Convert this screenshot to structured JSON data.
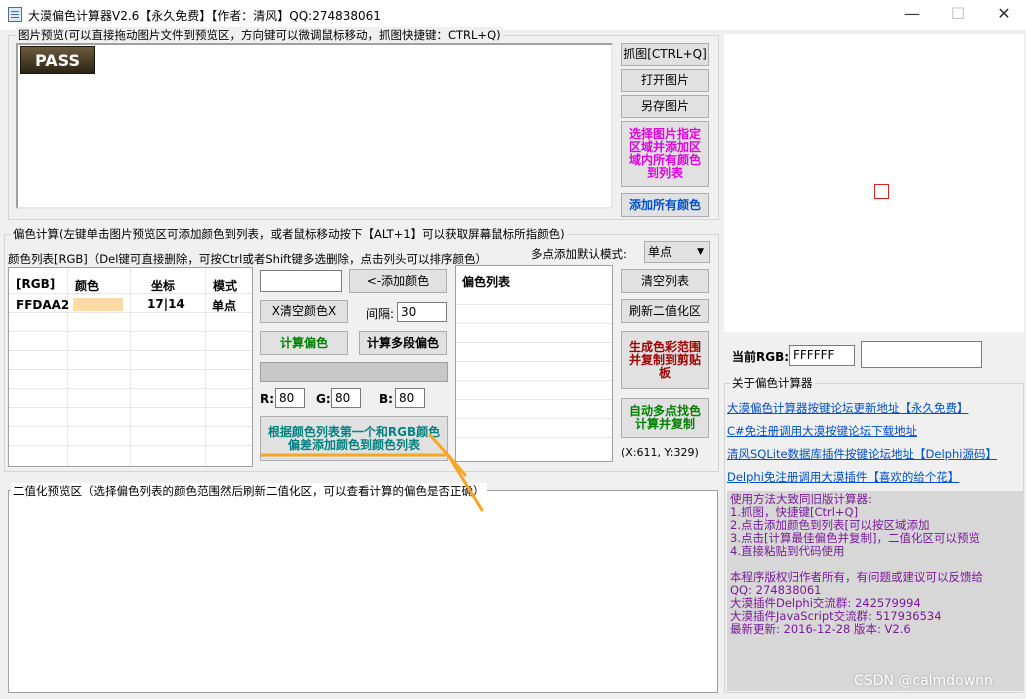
{
  "window": {
    "title": "大漠偏色计算器V2.6【永久免费】【作者：清风】QQ:274838061",
    "minimize": "—",
    "maximize": "☐",
    "close": "✕"
  },
  "preview_group": {
    "label": "图片预览(可以直接拖动图片文件到预览区，方向键可以微调鼠标移动，抓图快捷键：CTRL+Q)",
    "pass_image_text": "PASS"
  },
  "preview_buttons": {
    "capture": "抓图[CTRL+Q]",
    "open": "打开图片",
    "save_as": "另存图片",
    "select_region": "选择图片指定区域并添加区域内所有颜色到列表",
    "add_all": "添加所有颜色"
  },
  "calc_group": {
    "label": "偏色计算(左键单击图片预览区可添加颜色到列表，或者鼠标移动按下【ALT+1】可以获取屏幕鼠标所指颜色)",
    "list_label": "颜色列表[RGB]（Del键可直接删除，可按Ctrl或者Shift键多选删除，点击列头可以排序颜色）",
    "multi_mode_label": "多点添加默认模式:",
    "multi_mode_value": "单点"
  },
  "color_table": {
    "headers": [
      "[RGB]",
      "颜色",
      "坐标",
      "模式"
    ],
    "rows": [
      {
        "rgb": "FFDAA2",
        "swatch": "#FFDAA2",
        "coord": "17|14",
        "mode": "单点"
      }
    ]
  },
  "middle_controls": {
    "color_input": "",
    "add_color": "<-添加颜色",
    "clear_color": "X清空颜色X",
    "interval_label": "间隔:",
    "interval_value": "30",
    "calc_offset": "计算偏色",
    "calc_multi": "计算多段偏色",
    "r_label": "R:",
    "r_value": "80",
    "g_label": "G:",
    "g_value": "80",
    "b_label": "B:",
    "b_value": "80",
    "add_by_diff": "根据颜色列表第一个和RGB颜色偏差添加颜色到颜色列表"
  },
  "offset_list": {
    "header": "偏色列表"
  },
  "right_buttons": {
    "clear_list": "清空列表",
    "refresh_binary": "刷新二值化区",
    "gen_range": "生成色彩范围并复制到剪贴板",
    "auto_find": "自动多点找色计算并复制",
    "coord": "(X:611, Y:329)"
  },
  "current_rgb": {
    "label": "当前RGB:",
    "value": "FFFFFF",
    "swatch": "#FFFFFF"
  },
  "about": {
    "label": "关于偏色计算器",
    "links": [
      "大漠偏色计算器按键论坛更新地址【永久免费】",
      "C#免注册调用大漠按键论坛下载地址",
      "清风SQLite数据库插件按键论坛地址【Delphi源码】",
      "Delphi免注册调用大漠插件【喜欢的给个花】"
    ],
    "usage": [
      "使用方法大致同旧版计算器:",
      "1.抓图，快捷键[Ctrl+Q]",
      "2.点击添加颜色到列表[可以按区域添加",
      "3.点击[计算最佳偏色并复制]，二值化区可以预览",
      "4.直接粘贴到代码使用"
    ],
    "copyright": [
      "本程序版权归作者所有，有问题或建议可以反馈给",
      "QQ: 274838061",
      "大漠插件Delphi交流群: 242579994",
      "大漠插件JavaScript交流群: 517936534",
      "最新更新: 2016-12-28 版本: V2.6"
    ]
  },
  "binary_group": {
    "label": "二值化预览区（选择偏色列表的颜色范围然后刷新二值化区，可以查看计算的偏色是否正确）"
  },
  "watermark": "CSDN @calmdownn",
  "colors": {
    "magenta_button_text": "#e000e0",
    "blue_button_text": "#0050c8",
    "green_button_text": "#008000",
    "darkred_button_text": "#a00000",
    "teal_button_text": "#008080",
    "annotation_arrow": "#f5a623"
  }
}
